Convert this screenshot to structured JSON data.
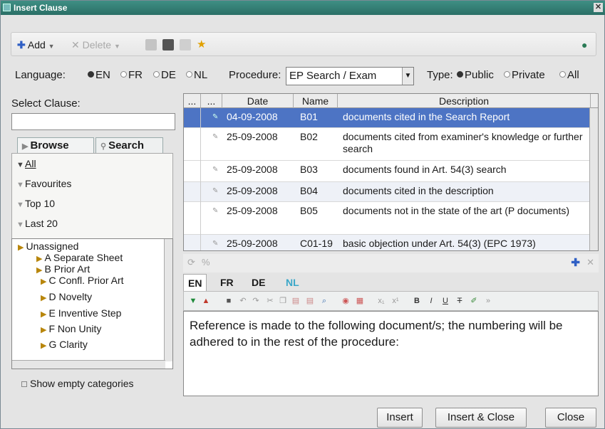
{
  "window": {
    "title": "Insert Clause"
  },
  "toolbar": {
    "add_label": "Add",
    "delete_label": "Delete",
    "icons": [
      "add-icon",
      "delete-icon",
      "grid-icon",
      "binoculars-icon",
      "list-icon",
      "star-icon",
      "person-icon"
    ]
  },
  "language_row": {
    "language_label": "Language:",
    "languages": [
      "EN",
      "FR",
      "DE",
      "NL"
    ],
    "selected_language": "EN",
    "procedure_label": "Procedure:",
    "procedure_value": "EP Search / Exam",
    "type_label": "Type:",
    "types": [
      "Public",
      "Private",
      "All"
    ],
    "selected_type": "Public"
  },
  "left": {
    "select_clause_label": "Select Clause:",
    "search_value": "",
    "tabs": [
      "Browse",
      "Search"
    ],
    "filters": [
      "All",
      "Favourites",
      "Top 10",
      "Last 20"
    ],
    "tree_root": "Unassigned",
    "tree_children": [
      "A Separate Sheet",
      "B Prior Art",
      "C Confl. Prior Art",
      "D Novelty",
      "E Inventive Step",
      "F Non Unity",
      "G Clarity"
    ],
    "show_empty_label": "Show empty categories"
  },
  "grid": {
    "columns": [
      "...",
      "...",
      "Date",
      "Name",
      "Description"
    ],
    "rows": [
      {
        "date": "04-09-2008",
        "name": "B01",
        "description": "documents cited in the Search Report",
        "selected": true
      },
      {
        "date": "25-09-2008",
        "name": "B02",
        "description": "documents cited from examiner's knowledge or further search"
      },
      {
        "date": "25-09-2008",
        "name": "B03",
        "description": "documents found in Art. 54(3) search"
      },
      {
        "date": "25-09-2008",
        "name": "B04",
        "description": "documents cited in the description"
      },
      {
        "date": "25-09-2008",
        "name": "B05",
        "description": "documents not in the state of the art (P documents)"
      },
      {
        "date": "25-09-2008",
        "name": "C01-19",
        "description": "basic objection under Art. 54(3) (EPC 1973)"
      }
    ]
  },
  "editor": {
    "tabs": [
      "EN",
      "FR",
      "DE",
      "NL"
    ],
    "active_tab": "EN",
    "content": "Reference is made to the following document/s; the numbering will be adhered to in the rest of the procedure:"
  },
  "buttons": {
    "insert": "Insert",
    "insert_close": "Insert & Close",
    "close": "Close"
  },
  "colors": {
    "titlebar": "#2f7f75",
    "selection": "#4d74c4",
    "nl_tab": "#3aa7c8"
  }
}
